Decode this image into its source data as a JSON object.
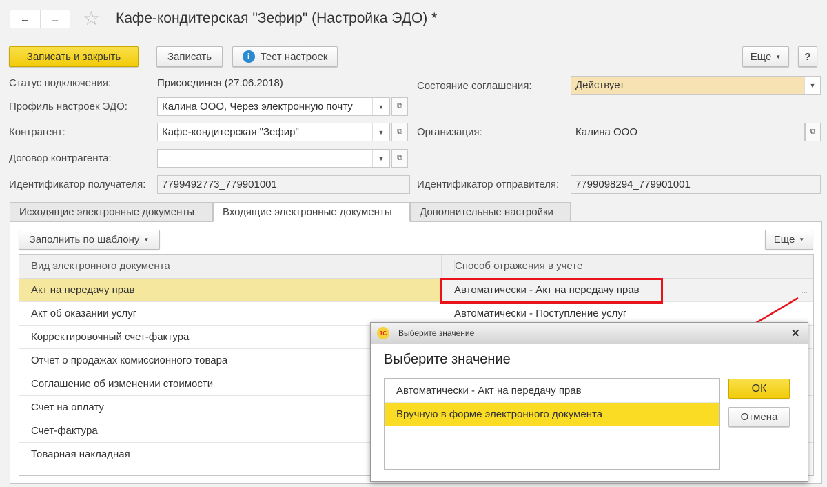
{
  "header": {
    "title": "Кафе-кондитерская \"Зефир\" (Настройка ЭДО) *",
    "back_icon": "←",
    "forward_icon": "→",
    "star_icon": "☆"
  },
  "toolbar": {
    "save_close": "Записать и закрыть",
    "save": "Записать",
    "test": "Тест настроек",
    "more": "Еще",
    "help": "?"
  },
  "form": {
    "status_label": "Статус подключения:",
    "status_value": "Присоединен (27.06.2018)",
    "profile_label": "Профиль настроек ЭДО:",
    "profile_value": "Калина ООО, Через электронную почту",
    "counterparty_label": "Контрагент:",
    "counterparty_value": "Кафе-кондитерская \"Зефир\"",
    "contract_label": "Договор контрагента:",
    "contract_value": "",
    "recipient_id_label": "Идентификатор получателя:",
    "recipient_id_value": "7799492773_779901001",
    "agreement_label": "Состояние соглашения:",
    "agreement_value": "Действует",
    "org_label": "Организация:",
    "org_value": "Калина ООО",
    "sender_id_label": "Идентификатор отправителя:",
    "sender_id_value": "7799098294_779901001"
  },
  "tabs": [
    "Исходящие электронные документы",
    "Входящие электронные документы",
    "Дополнительные настройки"
  ],
  "panel": {
    "fill_template": "Заполнить по шаблону",
    "more": "Еще",
    "ellipsis": "...",
    "columns": [
      "Вид электронного документа",
      "Способ отражения в учете"
    ],
    "rows": [
      {
        "doc": "Акт на передачу прав",
        "method": "Автоматически -  Акт на передачу прав"
      },
      {
        "doc": "Акт об оказании услуг",
        "method": "Автоматически -  Поступление услуг"
      },
      {
        "doc": "Корректировочный счет-фактура",
        "method": ""
      },
      {
        "doc": "Отчет о продажах комиссионного товара",
        "method": ""
      },
      {
        "doc": "Соглашение об изменении стоимости",
        "method": ""
      },
      {
        "doc": "Счет на оплату",
        "method": ""
      },
      {
        "doc": "Счет-фактура",
        "method": ""
      },
      {
        "doc": "Товарная накладная",
        "method": ""
      }
    ]
  },
  "dialog": {
    "window_title": "Выберите значение",
    "logo": "1С",
    "heading": "Выберите значение",
    "close": "✕",
    "options": [
      "Автоматически -  Акт на передачу прав",
      "Вручную в форме электронного документа"
    ],
    "ok": "ОК",
    "cancel": "Отмена"
  },
  "colors": {
    "accent": "#f2cb0a",
    "highlight": "#f5e79e",
    "annotation": "#e8131b"
  }
}
